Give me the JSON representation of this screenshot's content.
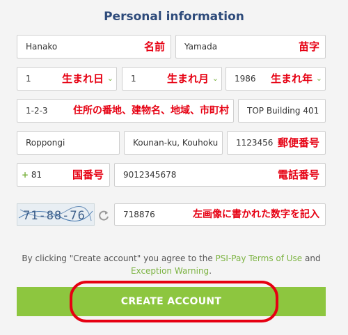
{
  "title": "Personal information",
  "fields": {
    "first_name": {
      "value": "Hanako",
      "annotation": "名前"
    },
    "last_name": {
      "value": "Yamada",
      "annotation": "苗字"
    },
    "birth_day": {
      "value": "1",
      "annotation": "生まれ日"
    },
    "birth_month": {
      "value": "1",
      "annotation": "生まれ月"
    },
    "birth_year": {
      "value": "1986",
      "annotation": "生まれ年"
    },
    "address1": {
      "value": "1-2-3",
      "annotation": "住所の番地、建物名、地域、市町村"
    },
    "address2": {
      "value": "TOP Building 401"
    },
    "city": {
      "value": "Roppongi"
    },
    "district": {
      "value": "Kounan-ku, Kouhoku"
    },
    "postal": {
      "value": "1123456",
      "annotation": "郵便番号"
    },
    "country_code": {
      "plus": "+",
      "value": "81",
      "annotation": "国番号"
    },
    "phone": {
      "value": "9012345678",
      "annotation": "電話番号"
    },
    "captcha_input": {
      "value": "718876",
      "annotation": "左画像に書かれた数字を記入"
    }
  },
  "captcha_text": "71-88-76",
  "terms": {
    "before": "By clicking \"Create account\" you agree to the ",
    "link1": "PSI-Pay Terms of Use",
    "middle": " and",
    "link2": "Exception Warning",
    "after": "."
  },
  "button_label": "CREATE ACCOUNT",
  "colors": {
    "accent": "#8dc63f",
    "annotation": "#e60012",
    "title": "#2d4a7a"
  },
  "icons": {
    "dropdown": "chevron-down-icon",
    "refresh": "refresh-icon"
  }
}
